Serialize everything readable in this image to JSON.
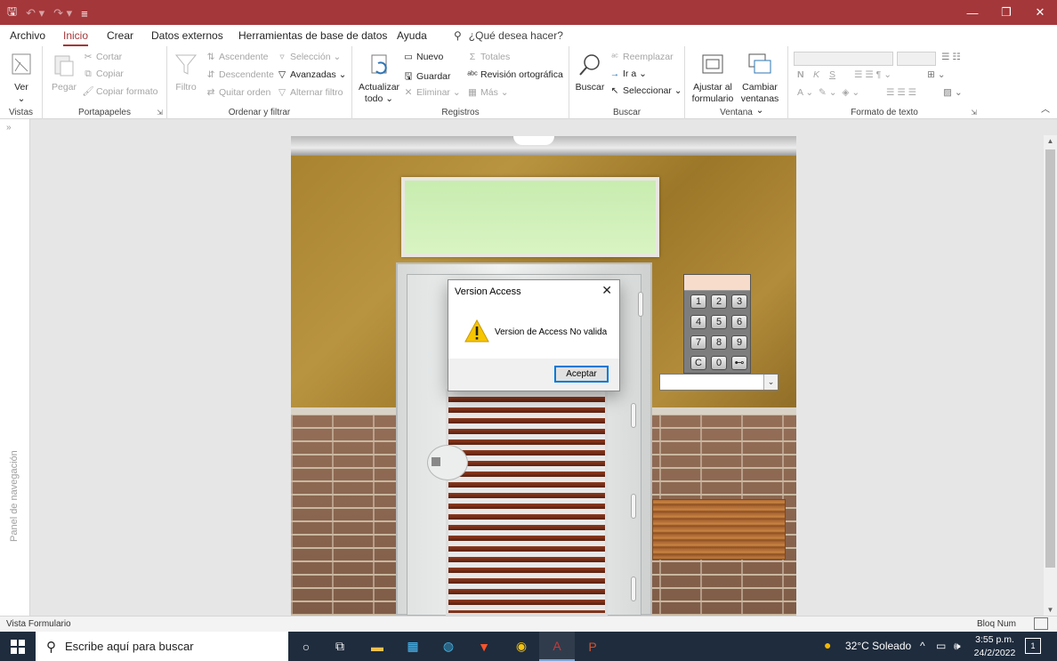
{
  "menu": {
    "tabs": [
      "Archivo",
      "Inicio",
      "Crear",
      "Datos externos",
      "Herramientas de base de datos",
      "Ayuda"
    ],
    "active": "Inicio",
    "tell_me": "¿Qué desea hacer?"
  },
  "ribbon": {
    "vistas": {
      "label": "Vistas",
      "ver": "Ver"
    },
    "portapapeles": {
      "label": "Portapapeles",
      "pegar": "Pegar",
      "cortar": "Cortar",
      "copiar": "Copiar",
      "copiar_formato": "Copiar formato"
    },
    "ordenar": {
      "label": "Ordenar y filtrar",
      "filtro": "Filtro",
      "ascendente": "Ascendente",
      "descendente": "Descendente",
      "quitar_orden": "Quitar orden",
      "seleccion": "Selección",
      "avanzadas": "Avanzadas",
      "alternar_filtro": "Alternar filtro"
    },
    "registros": {
      "label": "Registros",
      "actualizar": "Actualizar",
      "actualizar2": "todo",
      "nuevo": "Nuevo",
      "guardar": "Guardar",
      "eliminar": "Eliminar",
      "totales": "Totales",
      "revision": "Revisión ortográfica",
      "mas": "Más"
    },
    "buscar": {
      "label": "Buscar",
      "buscar": "Buscar",
      "reemplazar": "Reemplazar",
      "ir_a": "Ir a",
      "seleccionar": "Seleccionar"
    },
    "ventana": {
      "label": "Ventana",
      "ajustar1": "Ajustar al",
      "ajustar2": "formulario",
      "cambiar1": "Cambiar",
      "cambiar2": "ventanas"
    },
    "formato": {
      "label": "Formato de texto",
      "n": "N",
      "k": "K",
      "s": "S"
    }
  },
  "nav_pane": {
    "label": "Panel de navegación"
  },
  "keypad": {
    "keys": [
      "1",
      "2",
      "3",
      "4",
      "5",
      "6",
      "7",
      "8",
      "9",
      "C",
      "0",
      "⊷"
    ]
  },
  "dialog": {
    "title": "Version Access",
    "message": "Version de Access No valida",
    "button": "Aceptar"
  },
  "status": {
    "left": "Vista Formulario",
    "right": "Bloq Num"
  },
  "taskbar": {
    "search_placeholder": "Escribe aquí para buscar",
    "weather": "32°C  Soleado",
    "time": "3:55 p.m.",
    "date": "24/2/2022",
    "notifications": "1"
  },
  "colors": {
    "accent": "#a4373a",
    "taskbar": "#1f2c3d",
    "dialog_button_border": "#0078d7"
  }
}
